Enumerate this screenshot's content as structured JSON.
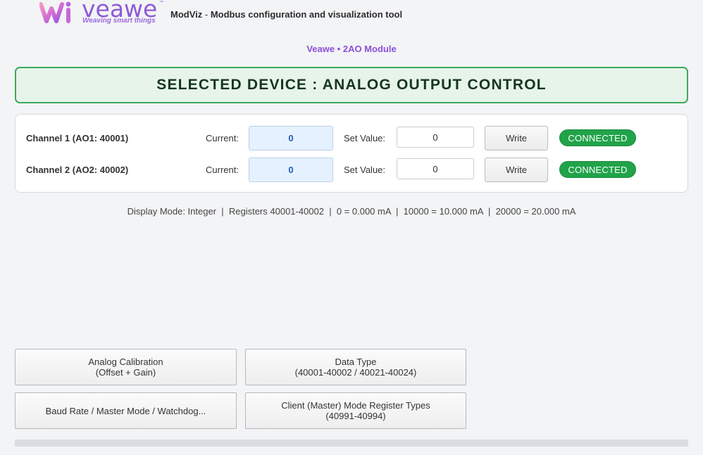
{
  "header": {
    "logo_word": "veawe",
    "logo_tm": "™",
    "logo_tagline": "Weaving smart things",
    "app_name": "ModViz",
    "app_sep": " - ",
    "app_desc": "Modbus configuration and visualization tool"
  },
  "module_label": "Veawe • 2AO Module",
  "banner": "SELECTED DEVICE : ANALOG OUTPUT CONTROL",
  "channels": [
    {
      "name": "Channel 1 (AO1: 40001)",
      "current_label": "Current:",
      "current_value": "0",
      "set_label": "Set Value:",
      "set_value": "0",
      "write_label": "Write",
      "status": "CONNECTED"
    },
    {
      "name": "Channel 2 (AO2: 40002)",
      "current_label": "Current:",
      "current_value": "0",
      "set_label": "Set Value:",
      "set_value": "0",
      "write_label": "Write",
      "status": "CONNECTED"
    }
  ],
  "info_line": "Display Mode: Integer  |  Registers 40001-40002  |  0 = 0.000 mA  |  10000 = 10.000 mA  |  20000 = 20.000 mA",
  "actions": {
    "calibration": {
      "line1": "Analog Calibration",
      "line2": "(Offset + Gain)"
    },
    "data_type": {
      "line1": "Data Type",
      "line2": "(40001-40002 / 40021-40024)"
    },
    "baud": {
      "line1": "Baud Rate / Master Mode / Watchdog..."
    },
    "client_master": {
      "line1": "Client (Master) Mode Register Types",
      "line2": "(40991-40994)"
    }
  },
  "colors": {
    "accent_purple": "#8a4fd8",
    "banner_border": "#3da95a",
    "banner_bg": "#e7f4ea",
    "status_green": "#21a34a",
    "current_bg": "#e6f1ff"
  },
  "icons": {
    "logo": "veawe-logo-icon"
  }
}
